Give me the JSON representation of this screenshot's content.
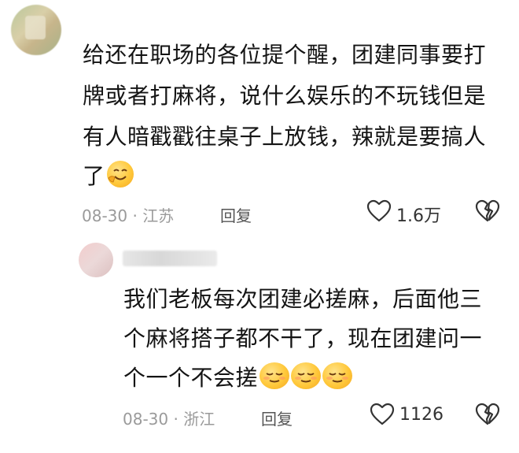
{
  "top_comment": {
    "lines": [
      "给还在职场的各位提个醒，团建同事要打",
      "牌或者打麻将，说什么娱乐的不玩钱但是",
      "有人暗戳戳往桌子上放钱，辣就是要搞人",
      "了"
    ],
    "date": "08-30",
    "location": "江苏",
    "reply_label": "回复",
    "likes": "1.6万"
  },
  "reply_comment": {
    "lines": [
      "我们老板每次团建必搓麻，后面他三",
      "个麻将搭子都不干了，现在团建问一",
      "个一个不会搓"
    ],
    "date": "08-30",
    "location": "浙江",
    "reply_label": "回复",
    "likes": "1126"
  },
  "separator": "·",
  "icons": [
    "heart-icon",
    "broken-heart-icon",
    "grin-emoji",
    "relieved-emoji"
  ]
}
